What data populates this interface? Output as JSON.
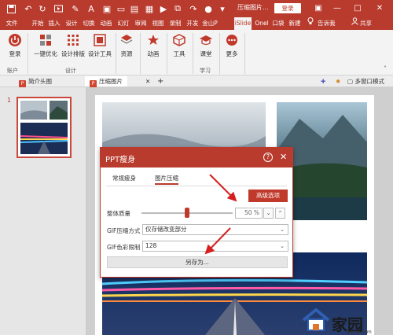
{
  "titlebar": {
    "doc_title": "压缩图片...",
    "login_label": "登录",
    "accent": "#b83b2e"
  },
  "menu": {
    "tabs": [
      "文件",
      "开始",
      "插入",
      "设计",
      "切换",
      "动画",
      "幻灯",
      "审阅",
      "视图",
      "录制",
      "开发",
      "金山P",
      "iSlide",
      "Onel",
      "口袋",
      "新建"
    ],
    "active_tab": "iSlide",
    "tell_me": "告诉我",
    "share": "共享"
  },
  "ribbon": {
    "login": "登录",
    "one_click": "一键优化",
    "design_layout": "设计排版",
    "design_tools": "设计工具",
    "resources": "资源",
    "animation": "动画",
    "tools": "工具",
    "classroom": "课堂",
    "more": "更多",
    "group_account": "账户",
    "group_design": "设计",
    "group_learn": "学习"
  },
  "doc_tabs": {
    "tab1": "简介头图",
    "tab2": "压缩图片",
    "multi_window": "多窗口模式"
  },
  "thumbnails": {
    "slide_number": "1"
  },
  "dialog": {
    "title": "PPT瘦身",
    "help": "?",
    "close": "✕",
    "tab_normal": "常规瘦身",
    "tab_image": "图片压缩",
    "advanced": "高级选项",
    "quality_label": "整体质量",
    "quality_value": "50 %",
    "quality_level": 0.5,
    "gif_compress_label": "GIF压缩方式",
    "gif_compress_value": "仅存储改变部分",
    "gif_color_label": "GIF色彩限制",
    "gif_color_value": "128",
    "save_as": "另存为..."
  },
  "watermark": {
    "brand": "家园",
    "url": "pptjia.com"
  }
}
